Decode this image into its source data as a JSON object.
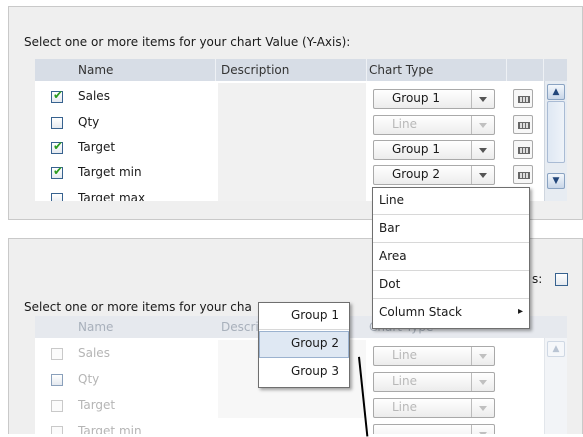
{
  "top_panel": {
    "heading": "Select one or more items for your chart Value (Y-Axis):",
    "columns": [
      "Name",
      "Description",
      "Chart Type"
    ],
    "rows": [
      {
        "checked": true,
        "name": "Sales",
        "chart_type": "Group 1",
        "combo_enabled": true
      },
      {
        "checked": false,
        "name": "Qty",
        "chart_type": "Line",
        "combo_enabled": false
      },
      {
        "checked": true,
        "name": "Target",
        "chart_type": "Group 1",
        "combo_enabled": true
      },
      {
        "checked": true,
        "name": "Target min",
        "chart_type": "Group 2",
        "combo_enabled": true
      },
      {
        "checked": false,
        "name": "Target max",
        "chart_type": "",
        "combo_enabled": true
      }
    ]
  },
  "bottom_panel": {
    "heading": "Select one or more items for your cha",
    "columns": [
      "Name",
      "Descri",
      "Chart Type"
    ],
    "partial_label": "s:",
    "rows": [
      {
        "name": "Sales",
        "chart_type": "Line"
      },
      {
        "name": "Qty",
        "chart_type": "Line"
      },
      {
        "name": "Target",
        "chart_type": "Line"
      },
      {
        "name": "Target min",
        "chart_type": "Line"
      }
    ]
  },
  "chart_type_menu": {
    "items": [
      "Line",
      "Bar",
      "Area",
      "Dot",
      "Column Stack"
    ],
    "submenu_indicator": "▸"
  },
  "group_menu": {
    "items": [
      "Group 1",
      "Group 2",
      "Group 3"
    ],
    "selected": "Group 2"
  },
  "colors": {
    "header_bg": "#d7dde6",
    "check_green": "#2a9a1f",
    "selection_bg": "#dfe8f3"
  },
  "icons": {
    "check": "✔",
    "scroll_up": "▲",
    "scroll_down": "▼"
  }
}
